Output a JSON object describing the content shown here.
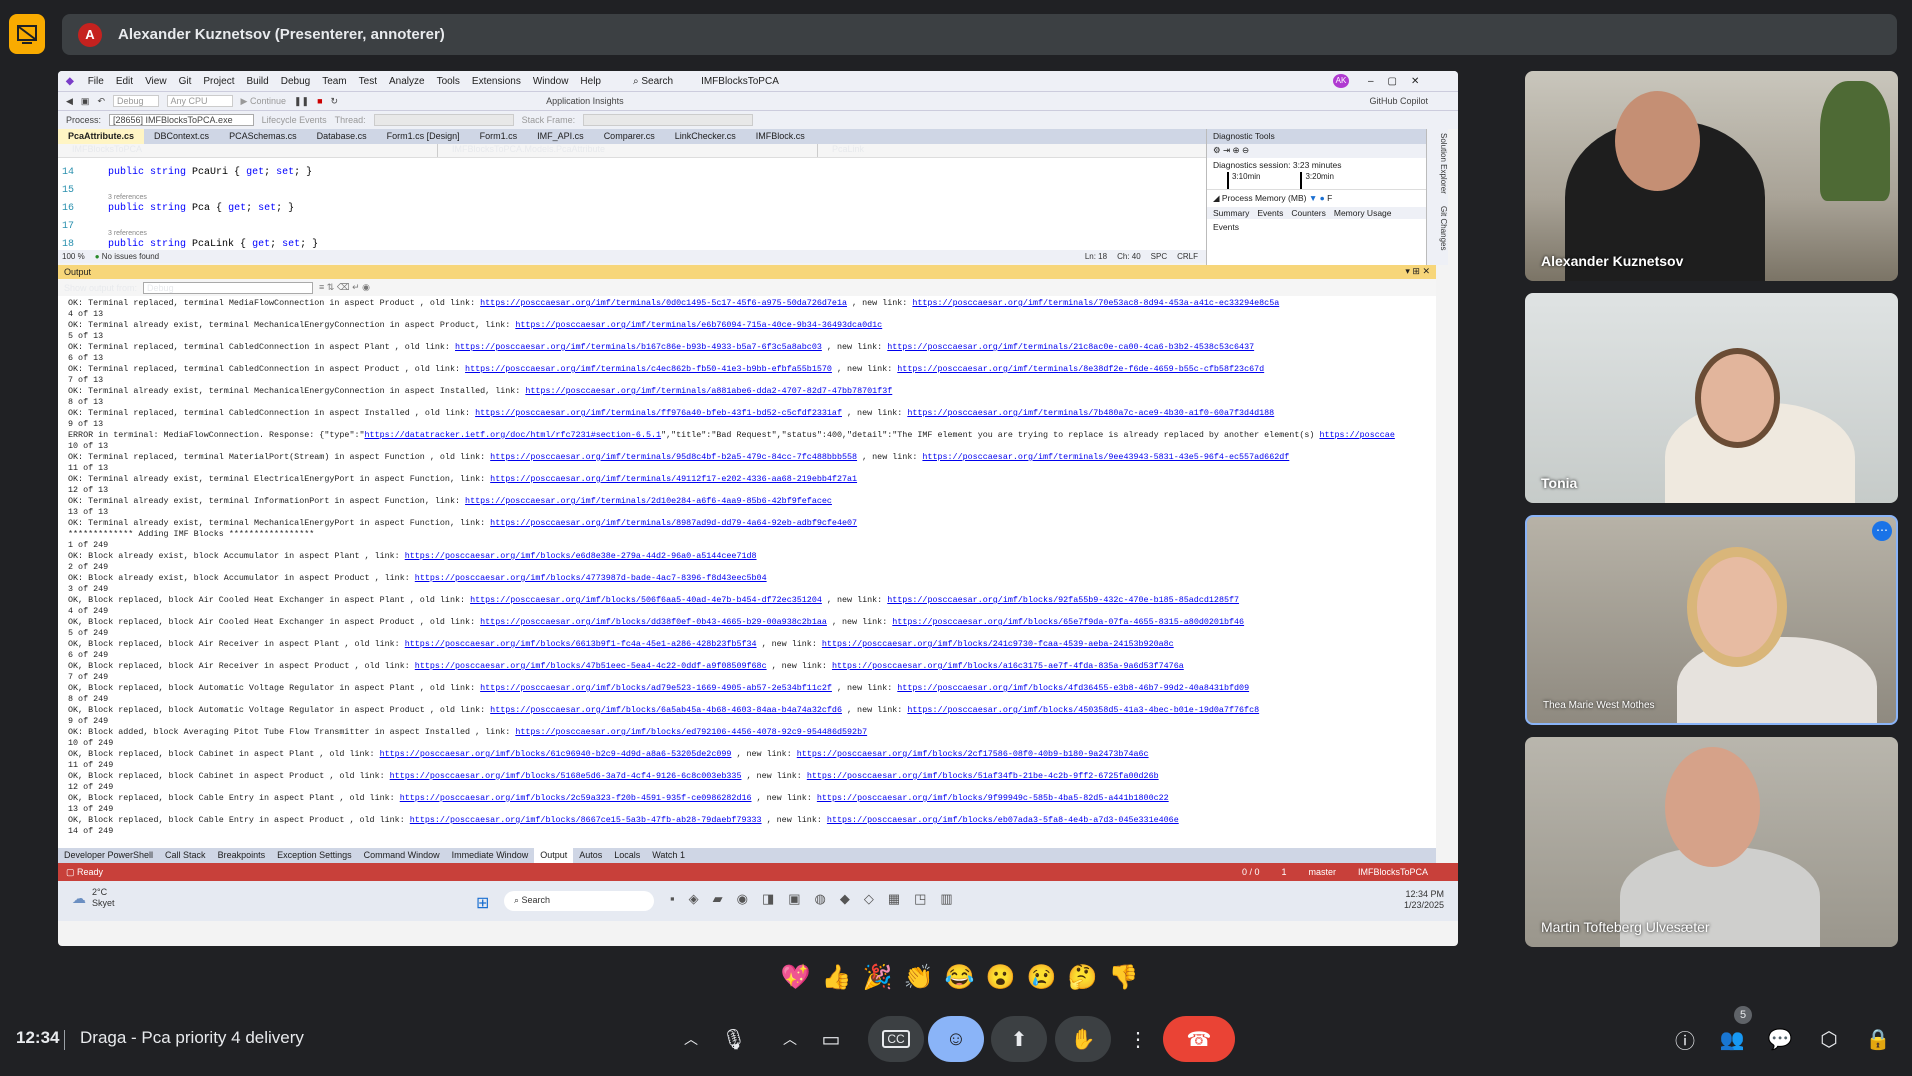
{
  "presenter": {
    "initial": "A",
    "name": "Alexander Kuznetsov (Presenterer, annoterer)"
  },
  "vs": {
    "menu": [
      "File",
      "Edit",
      "View",
      "Git",
      "Project",
      "Build",
      "Debug",
      "Team",
      "Test",
      "Analyze",
      "Tools",
      "Extensions",
      "Window",
      "Help"
    ],
    "search": "Search",
    "solution": "IMFBlocksToPCA",
    "user_initials": "AK",
    "process_label": "Process:",
    "process_value": "[28656] IMFBlocksToPCA.exe",
    "lifecycle": "Lifecycle Events",
    "thread": "Thread:",
    "stack_frame": "Stack Frame:",
    "continue": "Continue",
    "debug_cfg": "Debug",
    "cpu_cfg": "Any CPU",
    "app_insights": "Application Insights",
    "copilot": "GitHub Copilot",
    "tabs": [
      "PcaAttribute.cs",
      "DBContext.cs",
      "PCASchemas.cs",
      "Database.cs",
      "Form1.cs [Design]",
      "Form1.cs",
      "IMF_API.cs",
      "Comparer.cs",
      "LinkChecker.cs",
      "IMFBlock.cs"
    ],
    "nav_project": "IMFBlocksToPCA",
    "nav_class": "IMFBlocksToPCA.Models.PcaAttribute",
    "nav_member": "PcaLink",
    "code": [
      {
        "n": "14",
        "refs": "",
        "text": "public string PcaUri { get; set; }"
      },
      {
        "n": "15",
        "refs": "",
        "text": ""
      },
      {
        "n": "16",
        "refs": "3 references",
        "text": "public string Pca { get; set; }"
      },
      {
        "n": "17",
        "refs": "",
        "text": ""
      },
      {
        "n": "18",
        "refs": "3 references",
        "text": "public string PcaLink { get; set; }"
      }
    ],
    "zoom": "100 %",
    "issues": "No issues found",
    "ln": "Ln: 18",
    "ch": "Ch: 40",
    "spc": "SPC",
    "crlf": "CRLF",
    "diag": {
      "title": "Diagnostic Tools",
      "session": "Diagnostics session: 3:23 minutes",
      "t1": "3:10min",
      "t2": "3:20min",
      "memory": "Process Memory (MB)",
      "tabs": [
        "Summary",
        "Events",
        "Counters",
        "Memory Usage"
      ],
      "events": "Events"
    },
    "side_tabs": [
      "Solution Explorer",
      "Git Changes"
    ],
    "output_title": "Output",
    "show_from": "Show output from:",
    "show_from_value": "Debug",
    "output_lines": [
      [
        "OK: Terminal replaced, terminal MediaFlowConnection in aspect Product , old link: ",
        "https://posccaesar.org/imf/terminals/0d0c1495-5c17-45f6-a975-50da726d7e1a",
        " , new link: ",
        "https://posccaesar.org/imf/terminals/70e53ac8-8d94-453a-a41c-ec33294e8c5a"
      ],
      [
        "4 of 13"
      ],
      [
        "OK: Terminal already exist, terminal MechanicalEnergyConnection in aspect Product, link: ",
        "https://posccaesar.org/imf/terminals/e6b76094-715a-40ce-9b34-36493dca0d1c"
      ],
      [
        "5 of 13"
      ],
      [
        "OK: Terminal replaced, terminal CabledConnection in aspect Plant , old link: ",
        "https://posccaesar.org/imf/terminals/b167c86e-b93b-4933-b5a7-6f3c5a8abc03",
        " , new link: ",
        "https://posccaesar.org/imf/terminals/21c8ac0e-ca00-4ca6-b3b2-4538c53c6437"
      ],
      [
        "6 of 13"
      ],
      [
        "OK: Terminal replaced, terminal CabledConnection in aspect Product , old link: ",
        "https://posccaesar.org/imf/terminals/c4ec862b-fb50-41e3-b9bb-efbfa55b1570",
        " , new link: ",
        "https://posccaesar.org/imf/terminals/8e38df2e-f6de-4659-b55c-cfb58f23c67d"
      ],
      [
        "7 of 13"
      ],
      [
        "OK: Terminal already exist, terminal MechanicalEnergyConnection in aspect Installed, link: ",
        "https://posccaesar.org/imf/terminals/a881abe6-dda2-4707-82d7-47bb78701f3f"
      ],
      [
        "8 of 13"
      ],
      [
        "OK: Terminal replaced, terminal CabledConnection in aspect Installed , old link: ",
        "https://posccaesar.org/imf/terminals/ff976a40-bfeb-43f1-bd52-c5cfdf2331af",
        " , new link: ",
        "https://posccaesar.org/imf/terminals/7b480a7c-ace9-4b30-a1f0-60a7f3d4d188"
      ],
      [
        "9 of 13"
      ],
      [
        "ERROR in terminal: MediaFlowConnection. Response: {\"type\":\"",
        "https://datatracker.ietf.org/doc/html/rfc7231#section-6.5.1",
        "\",\"title\":\"Bad Request\",\"status\":400,\"detail\":\"The IMF element you are trying to replace is already replaced by another element(s) ",
        "https://posccae"
      ],
      [
        "10 of 13"
      ],
      [
        "OK: Terminal replaced, terminal MaterialPort(Stream) in aspect Function , old link: ",
        "https://posccaesar.org/imf/terminals/95d8c4bf-b2a5-479c-84cc-7fc488bbb558",
        " , new link: ",
        "https://posccaesar.org/imf/terminals/9ee43943-5831-43e5-96f4-ec557ad662df"
      ],
      [
        "11 of 13"
      ],
      [
        "OK: Terminal already exist, terminal ElectricalEnergyPort in aspect Function, link: ",
        "https://posccaesar.org/imf/terminals/49112f17-e202-4336-aa68-219ebb4f27a1"
      ],
      [
        "12 of 13"
      ],
      [
        "OK: Terminal already exist, terminal InformationPort in aspect Function, link: ",
        "https://posccaesar.org/imf/terminals/2d10e284-a6f6-4aa9-85b6-42bf9fefacec"
      ],
      [
        "13 of 13"
      ],
      [
        "OK: Terminal already exist, terminal MechanicalEnergyPort in aspect Function, link: ",
        "https://posccaesar.org/imf/terminals/8987ad9d-dd79-4a64-92eb-adbf9cfe4e07"
      ],
      [
        "************* Adding IMF Blocks *****************"
      ],
      [
        "1 of 249"
      ],
      [
        "OK: Block already exist, block Accumulator in aspect Plant , link: ",
        "https://posccaesar.org/imf/blocks/e6d8e38e-279a-44d2-96a0-a5144cee71d8"
      ],
      [
        "2 of 249"
      ],
      [
        "OK: Block already exist, block Accumulator in aspect Product , link: ",
        "https://posccaesar.org/imf/blocks/4773987d-bade-4ac7-8396-f8d43eec5b04"
      ],
      [
        "3 of 249"
      ],
      [
        "OK, Block replaced, block Air Cooled Heat Exchanger in aspect Plant , old link: ",
        "https://posccaesar.org/imf/blocks/506f6aa5-40ad-4e7b-b454-df72ec351204",
        " , new link: ",
        "https://posccaesar.org/imf/blocks/92fa55b9-432c-470e-b185-85adcd1285f7"
      ],
      [
        "4 of 249"
      ],
      [
        "OK, Block replaced, block Air Cooled Heat Exchanger in aspect Product , old link: ",
        "https://posccaesar.org/imf/blocks/dd38f0ef-0b43-4665-b29-00a938c2b1aa",
        " , new link: ",
        "https://posccaesar.org/imf/blocks/65e7f9da-07fa-4655-8315-a80d0201bf46"
      ],
      [
        "5 of 249"
      ],
      [
        "OK, Block replaced, block Air Receiver in aspect Plant , old link: ",
        "https://posccaesar.org/imf/blocks/6613b9f1-fc4a-45e1-a286-428b23fb5f34",
        " , new link: ",
        "https://posccaesar.org/imf/blocks/241c9730-fcaa-4539-aeba-24153b920a8c"
      ],
      [
        "6 of 249"
      ],
      [
        "OK, Block replaced, block Air Receiver in aspect Product , old link: ",
        "https://posccaesar.org/imf/blocks/47b51eec-5ea4-4c22-0ddf-a9f08509f68c",
        " , new link: ",
        "https://posccaesar.org/imf/blocks/a16c3175-ae7f-4fda-835a-9a6d53f7476a"
      ],
      [
        "7 of 249"
      ],
      [
        "OK, Block replaced, block Automatic Voltage Regulator in aspect Plant , old link: ",
        "https://posccaesar.org/imf/blocks/ad79e523-1669-4905-ab57-2e534bf11c2f",
        " , new link: ",
        "https://posccaesar.org/imf/blocks/4fd36455-e3b8-46b7-99d2-40a8431bfd09"
      ],
      [
        "8 of 249"
      ],
      [
        "OK, Block replaced, block Automatic Voltage Regulator in aspect Product , old link: ",
        "https://posccaesar.org/imf/blocks/6a5ab45a-4b68-4603-84aa-b4a74a32cfd6",
        " , new link: ",
        "https://posccaesar.org/imf/blocks/450358d5-41a3-4bec-b01e-19d0a7f76fc8"
      ],
      [
        "9 of 249"
      ],
      [
        "OK: Block added, block Averaging Pitot Tube Flow Transmitter in aspect Installed , link: ",
        "https://posccaesar.org/imf/blocks/ed792106-4456-4078-92c9-954486d592b7"
      ],
      [
        "10 of 249"
      ],
      [
        "OK, Block replaced, block Cabinet in aspect Plant , old link: ",
        "https://posccaesar.org/imf/blocks/61c96940-b2c9-4d9d-a8a6-53205de2c099",
        " , new link: ",
        "https://posccaesar.org/imf/blocks/2cf17586-08f0-40b9-b180-9a2473b74a6c"
      ],
      [
        "11 of 249"
      ],
      [
        "OK, Block replaced, block Cabinet in aspect Product , old link: ",
        "https://posccaesar.org/imf/blocks/5168e5d6-3a7d-4cf4-9126-6c8c003eb335",
        " , new link: ",
        "https://posccaesar.org/imf/blocks/51af34fb-21be-4c2b-9ff2-6725fa00d26b"
      ],
      [
        "12 of 249"
      ],
      [
        "OK, Block replaced, block Cable Entry in aspect Plant , old link: ",
        "https://posccaesar.org/imf/blocks/2c59a323-f20b-4591-935f-ce0986282d16",
        " , new link: ",
        "https://posccaesar.org/imf/blocks/9f99949c-585b-4ba5-82d5-a441b1800c22"
      ],
      [
        "13 of 249"
      ],
      [
        "OK, Block replaced, block Cable Entry in aspect Product , old link: ",
        "https://posccaesar.org/imf/blocks/8667ce15-5a3b-47fb-ab28-79daebf79333",
        " , new link: ",
        "https://posccaesar.org/imf/blocks/eb07ada3-5fa8-4e4b-a7d3-045e331e406e"
      ],
      [
        "14 of 249"
      ]
    ],
    "bottom_tabs": [
      "Developer PowerShell",
      "Call Stack",
      "Breakpoints",
      "Exception Settings",
      "Command Window",
      "Immediate Window",
      "Output",
      "Autos",
      "Locals",
      "Watch 1"
    ],
    "status_ready": "Ready",
    "status_right": [
      "0 / 0",
      "1",
      "master",
      "IMFBlocksToPCA"
    ],
    "weather_temp": "2°C",
    "weather_desc": "Skyet",
    "task_search": "Search",
    "task_time": "12:34 PM",
    "task_date": "1/23/2025"
  },
  "participants": [
    {
      "name": "Alexander Kuznetsov"
    },
    {
      "name": "Tonia"
    },
    {
      "name": "Thea Marie West Mothes"
    },
    {
      "name": "Martin Tofteberg Ulvesæter"
    }
  ],
  "reactions": [
    "💖",
    "👍",
    "🎉",
    "👏",
    "😂",
    "😮",
    "😢",
    "🤔",
    "👎"
  ],
  "footer": {
    "time": "12:34",
    "meeting": "Draga - Pca priority 4 delivery",
    "people_count": "5"
  },
  "colors": {
    "accent": "#f9ab00",
    "end_call": "#ea4335",
    "active_btn": "#8ab4f8",
    "status_bar": "#c8403a"
  }
}
